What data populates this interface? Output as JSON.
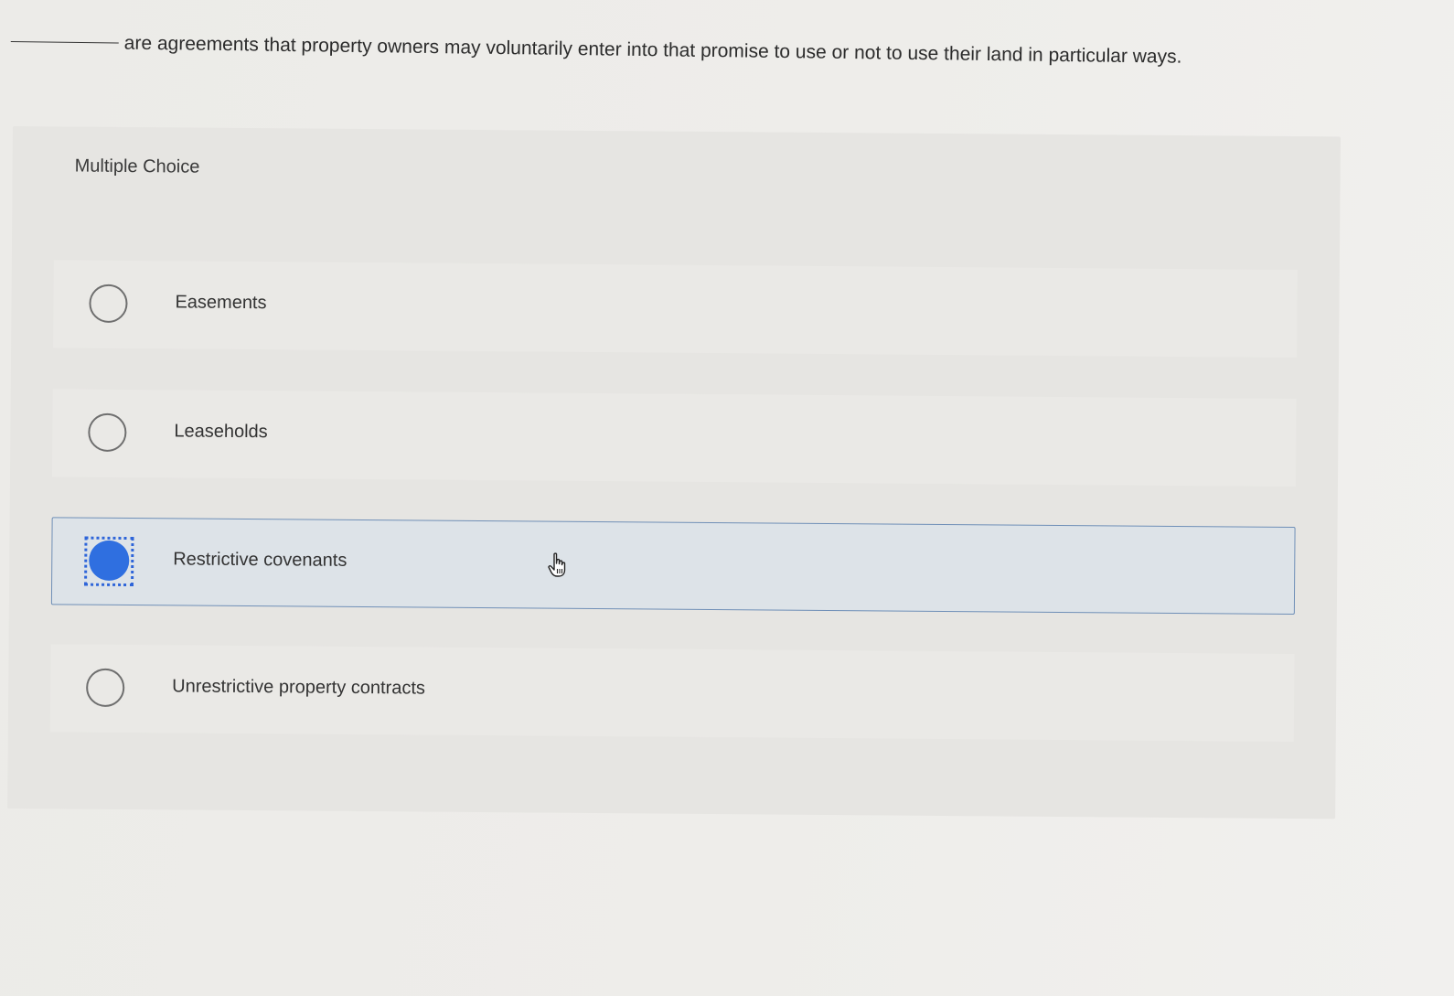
{
  "question": {
    "text": "are agreements that property owners may voluntarily enter into that promise to use or not to use their land in particular ways."
  },
  "multiple_choice": {
    "label": "Multiple Choice",
    "options": [
      {
        "label": "Easements",
        "selected": false
      },
      {
        "label": "Leaseholds",
        "selected": false
      },
      {
        "label": "Restrictive covenants",
        "selected": true
      },
      {
        "label": "Unrestrictive property contracts",
        "selected": false
      }
    ]
  },
  "colors": {
    "selected_fill": "#2f6fe0",
    "selected_border": "#6f8fb7",
    "selected_background": "#dde3e8"
  },
  "icons": {
    "cursor": "hand-pointer-icon"
  }
}
